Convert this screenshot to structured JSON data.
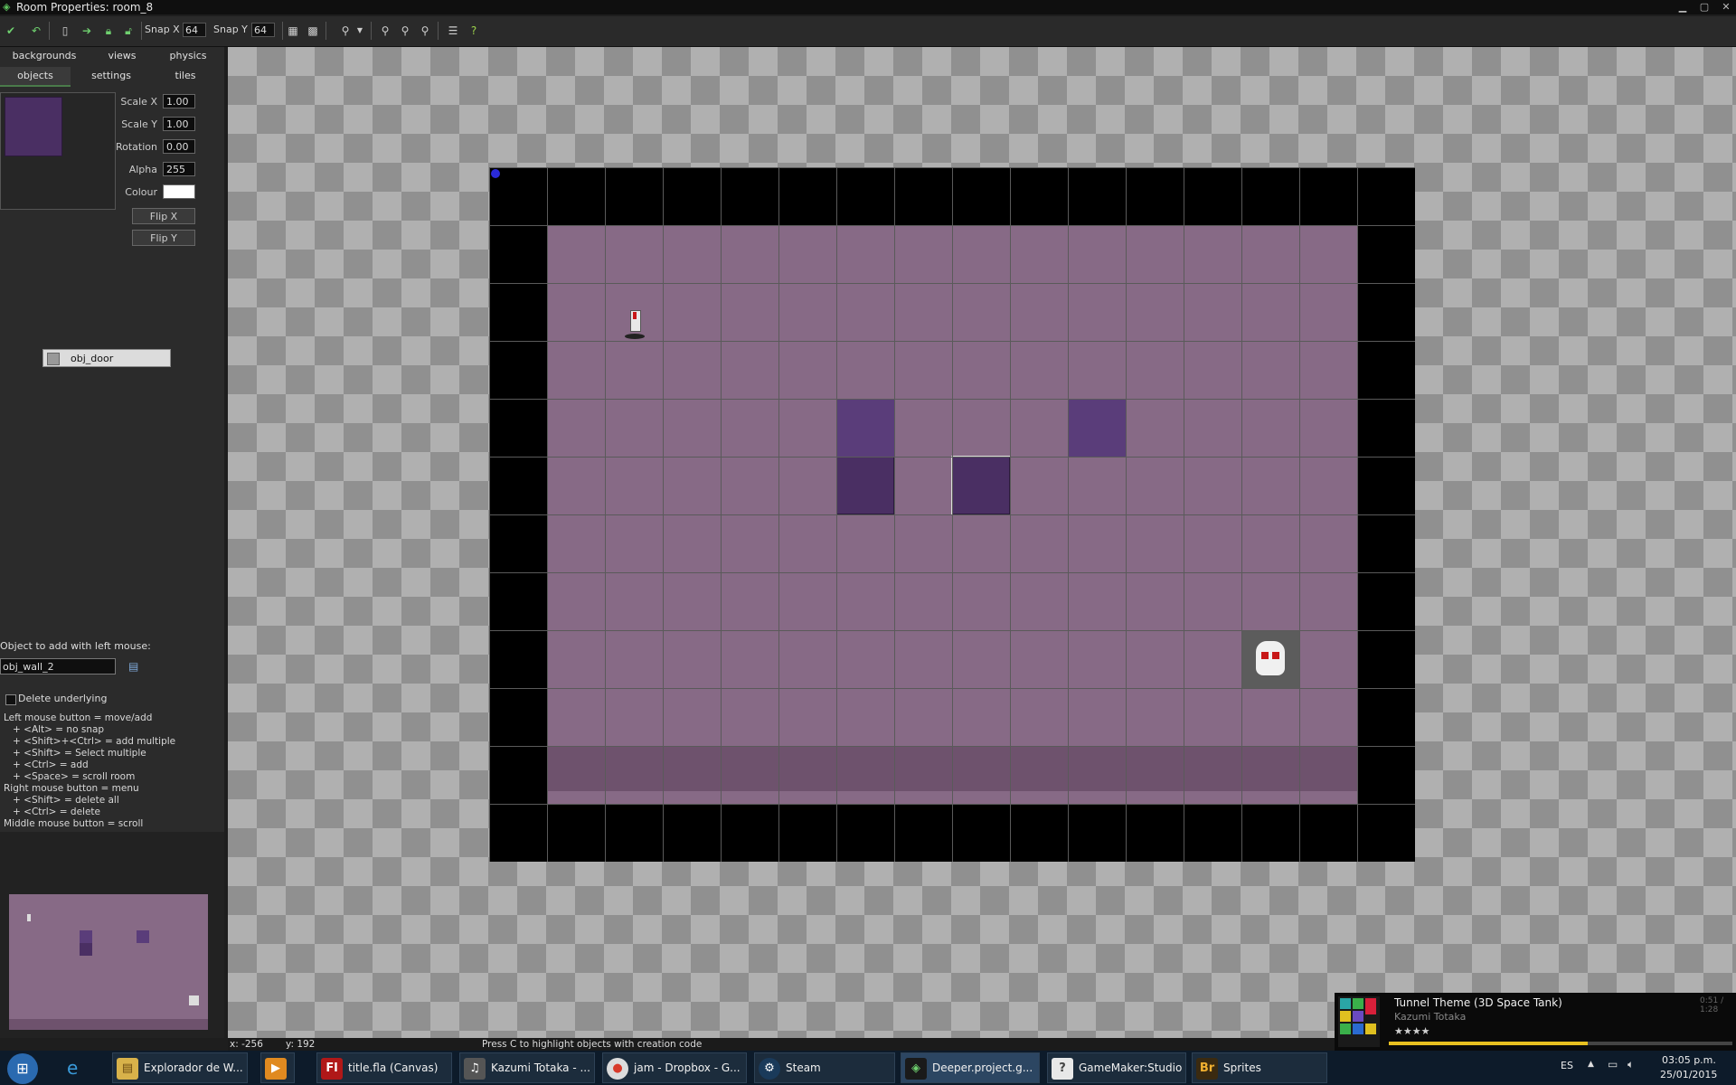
{
  "window": {
    "title": "Room Properties: room_8",
    "app_icon": "gamemaker-icon",
    "controls": [
      "minimize-icon",
      "maximize-icon",
      "close-icon"
    ]
  },
  "toolbar": {
    "snap_x_label": "Snap X",
    "snap_x_value": "64",
    "snap_y_label": "Snap Y",
    "snap_y_value": "64"
  },
  "tabs": {
    "backgrounds": "backgrounds",
    "views": "views",
    "physics": "physics",
    "objects": "objects",
    "settings": "settings",
    "tiles": "tiles",
    "selected": "objects"
  },
  "properties": {
    "scale_x_label": "Scale X",
    "scale_x": "1.00",
    "scale_y_label": "Scale Y",
    "scale_y": "1.00",
    "rotation_label": "Rotation",
    "rotation": "0.00",
    "alpha_label": "Alpha",
    "alpha": "255",
    "colour_label": "Colour",
    "colour": "#ffffff",
    "flip_x": "Flip X",
    "flip_y": "Flip Y"
  },
  "selected_object": "obj_door",
  "add_object": {
    "label": "Object to add with left mouse:",
    "value": "obj_wall_2",
    "delete_underlying": "Delete underlying"
  },
  "help_lines": [
    "Left mouse button = move/add",
    "   + <Alt> = no snap",
    "   + <Shift>+<Ctrl> = add multiple",
    "   + <Shift> = Select multiple",
    "   + <Ctrl> = add",
    "   + <Space> = scroll room",
    "Right mouse button = menu",
    "   + <Shift> = delete all",
    "   + <Ctrl> = delete",
    "Middle mouse button = scroll"
  ],
  "status": {
    "x": "x: -256",
    "y": "y: 192",
    "hint": "Press C to highlight objects with creation code"
  },
  "colors": {
    "floor": "#876a86",
    "wall": "#000000",
    "block": "#5a3d7a"
  },
  "taskbar": {
    "items": [
      {
        "icon": "file-explorer-icon",
        "label": "Explorador de W..."
      },
      {
        "icon": "media-player-icon",
        "label": ""
      },
      {
        "icon": "flash-icon",
        "label": "title.fla (Canvas)"
      },
      {
        "icon": "music-player-icon",
        "label": "Kazumi Totaka - ..."
      },
      {
        "icon": "chrome-icon",
        "label": "jam - Dropbox - G..."
      },
      {
        "icon": "steam-icon",
        "label": "Steam"
      },
      {
        "icon": "gamemaker-icon",
        "label": "Deeper.project.g..."
      },
      {
        "icon": "gamemaker-studio-icon",
        "label": "GameMaker:Studio"
      },
      {
        "icon": "bridge-icon",
        "label": "Sprites"
      }
    ],
    "lang": "ES",
    "time": "03:05 p.m.",
    "date": "25/01/2015"
  },
  "media": {
    "track": "Tunnel Theme (3D Space Tank)",
    "artist": "Kazumi Totaka",
    "elapsed": "0:51 / 1:28"
  }
}
